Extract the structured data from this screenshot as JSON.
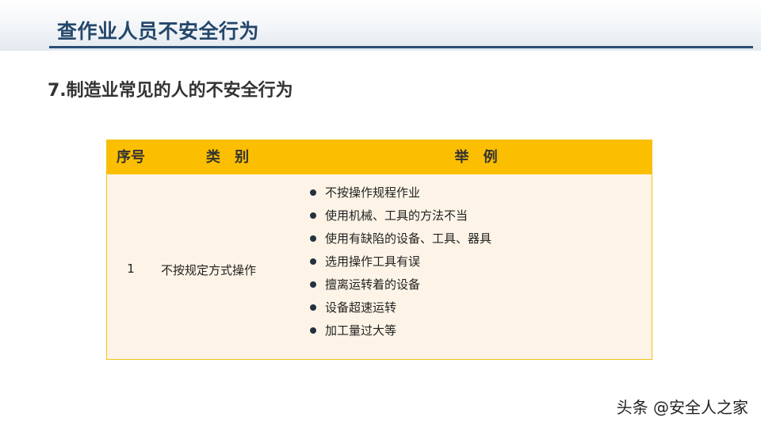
{
  "header": {
    "title": "查作业人员不安全行为"
  },
  "subtitle": "7.制造业常见的人的不安全行为",
  "table": {
    "columns": [
      "序号",
      "类 别",
      "举 例"
    ],
    "rows": [
      {
        "no": "1",
        "category": "不按规定方式操作",
        "examples": [
          "不按操作规程作业",
          "使用机械、工具的方法不当",
          "使用有缺陷的设备、工具、器具",
          "选用操作工具有误",
          "擅离运转着的设备",
          "设备超速运转",
          "加工量过大等"
        ]
      }
    ]
  },
  "watermark": "头条 @安全人之家",
  "colors": {
    "title": "#24466a",
    "rule": "#2b4f75",
    "table_header": "#fbbe00",
    "table_body": "#fdf4e7",
    "table_border": "#f3c21a"
  }
}
